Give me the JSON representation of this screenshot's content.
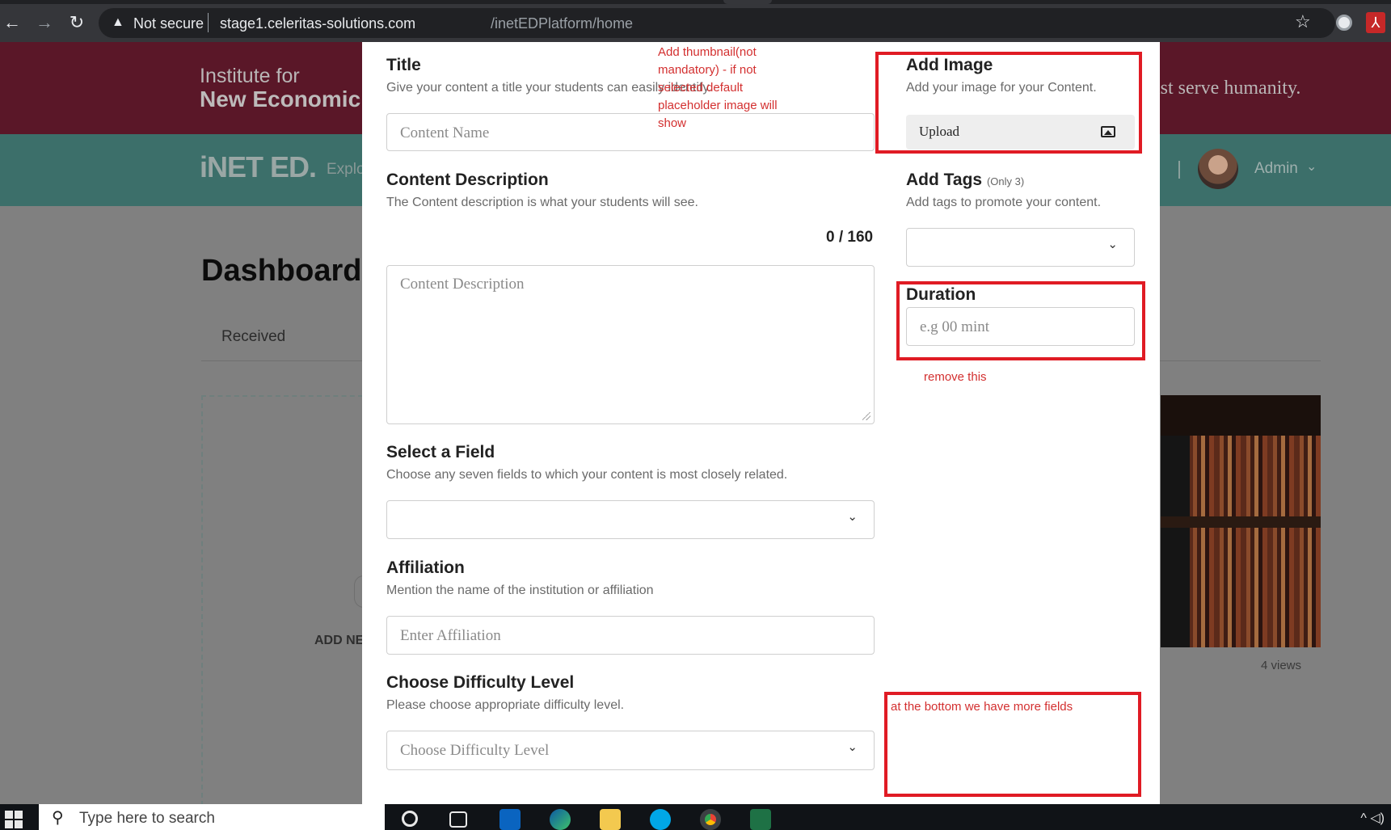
{
  "browser": {
    "security_label": "Not secure",
    "url_host": "stage1.celeritas-solutions.com",
    "url_path": "/inetEDPlatform/home",
    "back_icon": "←",
    "forward_icon": "→",
    "reload_icon": "↻",
    "warn_icon": "▲",
    "star_icon": "☆",
    "pdf_icon": "⅄"
  },
  "site": {
    "institute_line1": "Institute for",
    "institute_line2": "New Economic",
    "tagline": "must serve humanity.",
    "logo": "iNET ED.",
    "nav_explore": "Explo",
    "user_label": "Admin",
    "user_chevron": "⌄",
    "dashboard_title": "Dashboard",
    "tab_received": "Received",
    "add_new_label": "ADD NE",
    "views": "4 views"
  },
  "modal": {
    "title": {
      "label": "Title",
      "hint": "Give your content a title your students can easily identify.",
      "placeholder": "Content Name"
    },
    "description": {
      "label": "Content Description",
      "hint": "The Content description is what your students will see.",
      "counter": "0 / 160",
      "placeholder": "Content Description"
    },
    "field": {
      "label": "Select a Field",
      "hint": "Choose any seven fields to which your content is most closely related.",
      "chevron": "⌄"
    },
    "affiliation": {
      "label": "Affiliation",
      "hint": "Mention the name of the institution or affiliation",
      "placeholder": "Enter Affiliation"
    },
    "difficulty": {
      "label": "Choose Difficulty Level",
      "hint": "Please choose appropriate difficulty level.",
      "placeholder": "Choose Difficulty Level",
      "chevron": "⌄"
    },
    "image": {
      "label": "Add Image",
      "hint": "Add your image for your Content.",
      "upload_label": "Upload"
    },
    "tags": {
      "label": "Add Tags",
      "qualifier": "(Only 3)",
      "hint": "Add tags to promote your content.",
      "chevron": "⌄"
    },
    "duration": {
      "label": "Duration",
      "placeholder": "e.g 00 mint"
    }
  },
  "annotations": {
    "thumbnail_note": [
      "Add thumbnail(not",
      "mandatory) - if not",
      "selected default",
      "placeholder image will",
      "show"
    ],
    "remove_note": "remove this",
    "bottom_note": "at the bottom we have more fields",
    "color": "#e01b24"
  },
  "taskbar": {
    "search_placeholder": "Type here to search",
    "search_icon": "⚲"
  }
}
